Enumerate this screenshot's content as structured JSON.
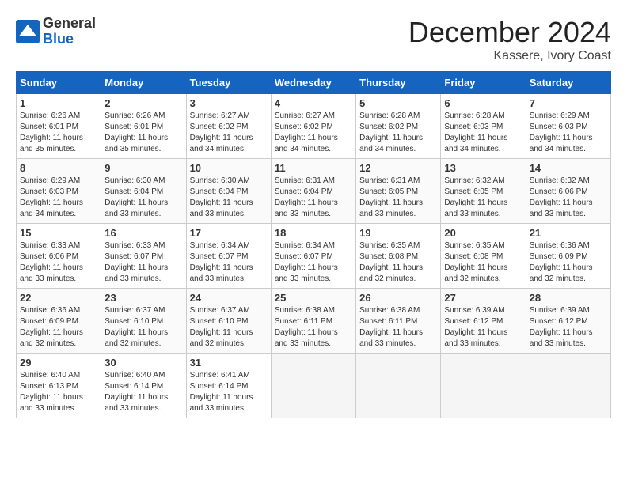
{
  "header": {
    "logo_line1": "General",
    "logo_line2": "Blue",
    "month": "December 2024",
    "location": "Kassere, Ivory Coast"
  },
  "weekdays": [
    "Sunday",
    "Monday",
    "Tuesday",
    "Wednesday",
    "Thursday",
    "Friday",
    "Saturday"
  ],
  "weeks": [
    [
      {
        "day": "1",
        "info": "Sunrise: 6:26 AM\nSunset: 6:01 PM\nDaylight: 11 hours\nand 35 minutes."
      },
      {
        "day": "2",
        "info": "Sunrise: 6:26 AM\nSunset: 6:01 PM\nDaylight: 11 hours\nand 35 minutes."
      },
      {
        "day": "3",
        "info": "Sunrise: 6:27 AM\nSunset: 6:02 PM\nDaylight: 11 hours\nand 34 minutes."
      },
      {
        "day": "4",
        "info": "Sunrise: 6:27 AM\nSunset: 6:02 PM\nDaylight: 11 hours\nand 34 minutes."
      },
      {
        "day": "5",
        "info": "Sunrise: 6:28 AM\nSunset: 6:02 PM\nDaylight: 11 hours\nand 34 minutes."
      },
      {
        "day": "6",
        "info": "Sunrise: 6:28 AM\nSunset: 6:03 PM\nDaylight: 11 hours\nand 34 minutes."
      },
      {
        "day": "7",
        "info": "Sunrise: 6:29 AM\nSunset: 6:03 PM\nDaylight: 11 hours\nand 34 minutes."
      }
    ],
    [
      {
        "day": "8",
        "info": "Sunrise: 6:29 AM\nSunset: 6:03 PM\nDaylight: 11 hours\nand 34 minutes."
      },
      {
        "day": "9",
        "info": "Sunrise: 6:30 AM\nSunset: 6:04 PM\nDaylight: 11 hours\nand 33 minutes."
      },
      {
        "day": "10",
        "info": "Sunrise: 6:30 AM\nSunset: 6:04 PM\nDaylight: 11 hours\nand 33 minutes."
      },
      {
        "day": "11",
        "info": "Sunrise: 6:31 AM\nSunset: 6:04 PM\nDaylight: 11 hours\nand 33 minutes."
      },
      {
        "day": "12",
        "info": "Sunrise: 6:31 AM\nSunset: 6:05 PM\nDaylight: 11 hours\nand 33 minutes."
      },
      {
        "day": "13",
        "info": "Sunrise: 6:32 AM\nSunset: 6:05 PM\nDaylight: 11 hours\nand 33 minutes."
      },
      {
        "day": "14",
        "info": "Sunrise: 6:32 AM\nSunset: 6:06 PM\nDaylight: 11 hours\nand 33 minutes."
      }
    ],
    [
      {
        "day": "15",
        "info": "Sunrise: 6:33 AM\nSunset: 6:06 PM\nDaylight: 11 hours\nand 33 minutes."
      },
      {
        "day": "16",
        "info": "Sunrise: 6:33 AM\nSunset: 6:07 PM\nDaylight: 11 hours\nand 33 minutes."
      },
      {
        "day": "17",
        "info": "Sunrise: 6:34 AM\nSunset: 6:07 PM\nDaylight: 11 hours\nand 33 minutes."
      },
      {
        "day": "18",
        "info": "Sunrise: 6:34 AM\nSunset: 6:07 PM\nDaylight: 11 hours\nand 33 minutes."
      },
      {
        "day": "19",
        "info": "Sunrise: 6:35 AM\nSunset: 6:08 PM\nDaylight: 11 hours\nand 32 minutes."
      },
      {
        "day": "20",
        "info": "Sunrise: 6:35 AM\nSunset: 6:08 PM\nDaylight: 11 hours\nand 32 minutes."
      },
      {
        "day": "21",
        "info": "Sunrise: 6:36 AM\nSunset: 6:09 PM\nDaylight: 11 hours\nand 32 minutes."
      }
    ],
    [
      {
        "day": "22",
        "info": "Sunrise: 6:36 AM\nSunset: 6:09 PM\nDaylight: 11 hours\nand 32 minutes."
      },
      {
        "day": "23",
        "info": "Sunrise: 6:37 AM\nSunset: 6:10 PM\nDaylight: 11 hours\nand 32 minutes."
      },
      {
        "day": "24",
        "info": "Sunrise: 6:37 AM\nSunset: 6:10 PM\nDaylight: 11 hours\nand 32 minutes."
      },
      {
        "day": "25",
        "info": "Sunrise: 6:38 AM\nSunset: 6:11 PM\nDaylight: 11 hours\nand 33 minutes."
      },
      {
        "day": "26",
        "info": "Sunrise: 6:38 AM\nSunset: 6:11 PM\nDaylight: 11 hours\nand 33 minutes."
      },
      {
        "day": "27",
        "info": "Sunrise: 6:39 AM\nSunset: 6:12 PM\nDaylight: 11 hours\nand 33 minutes."
      },
      {
        "day": "28",
        "info": "Sunrise: 6:39 AM\nSunset: 6:12 PM\nDaylight: 11 hours\nand 33 minutes."
      }
    ],
    [
      {
        "day": "29",
        "info": "Sunrise: 6:40 AM\nSunset: 6:13 PM\nDaylight: 11 hours\nand 33 minutes."
      },
      {
        "day": "30",
        "info": "Sunrise: 6:40 AM\nSunset: 6:14 PM\nDaylight: 11 hours\nand 33 minutes."
      },
      {
        "day": "31",
        "info": "Sunrise: 6:41 AM\nSunset: 6:14 PM\nDaylight: 11 hours\nand 33 minutes."
      },
      null,
      null,
      null,
      null
    ]
  ]
}
